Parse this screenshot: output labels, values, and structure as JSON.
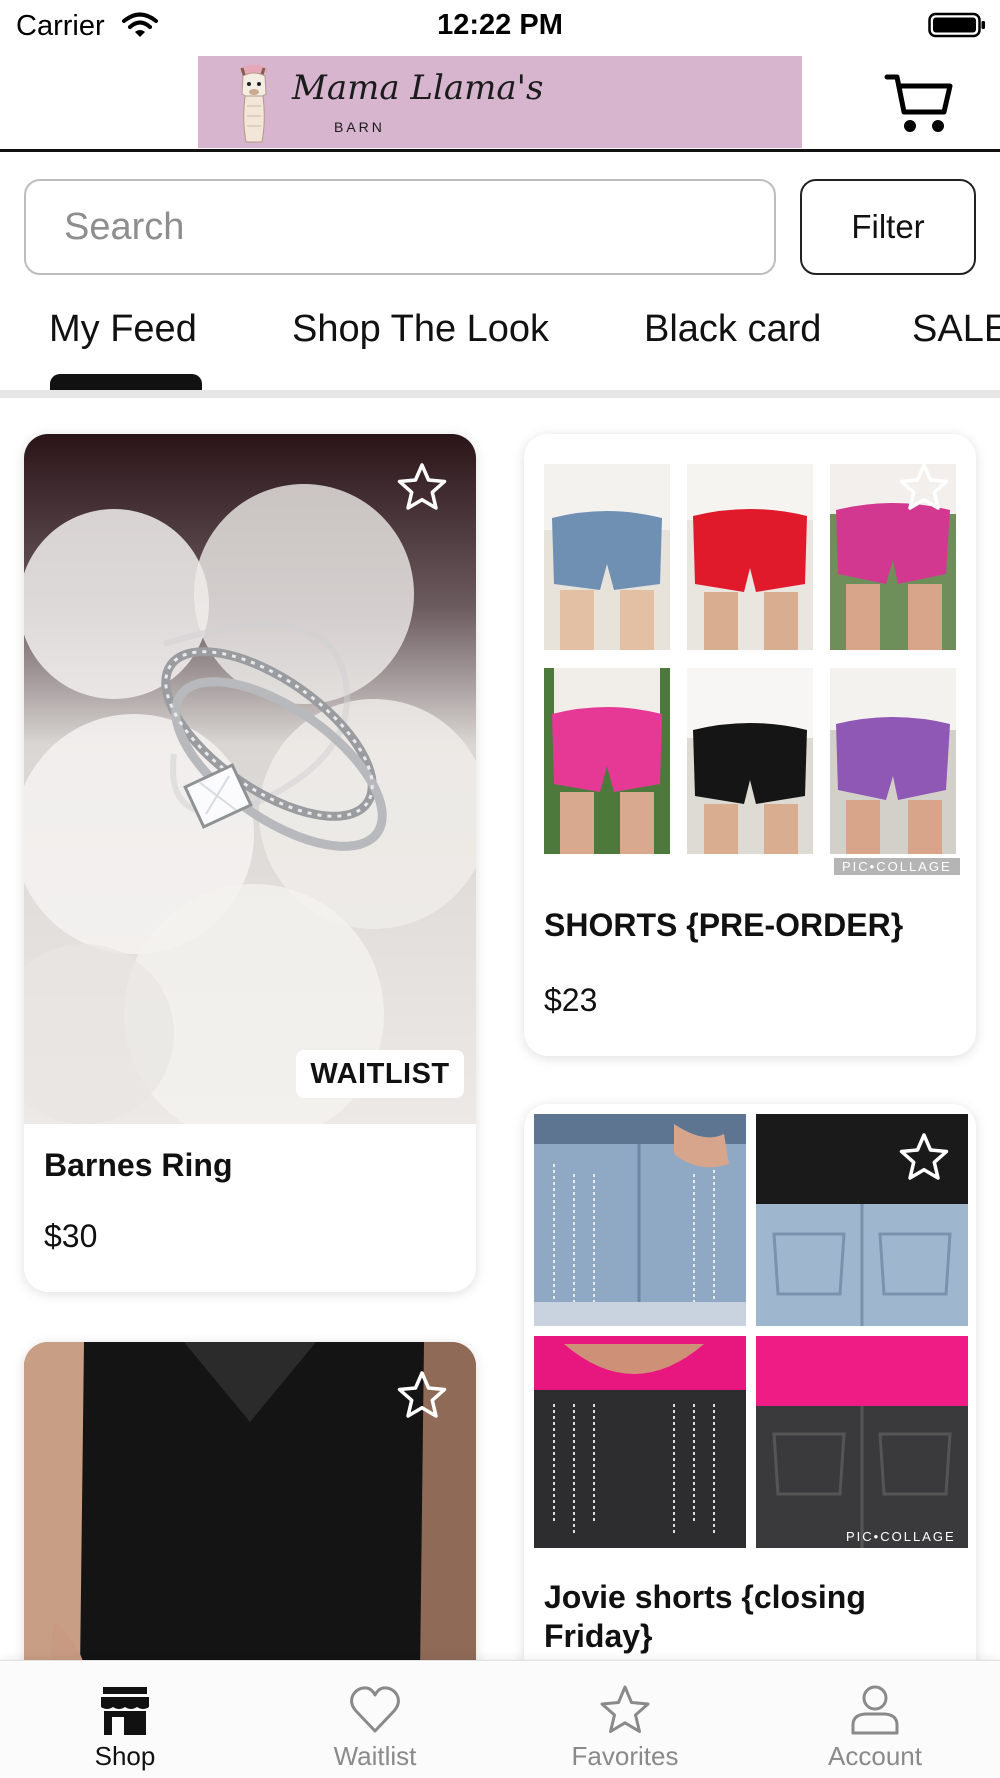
{
  "status_bar": {
    "carrier": "Carrier",
    "time": "12:22 PM"
  },
  "header": {
    "logo_script": "Mama Llama's",
    "logo_sub": "BARN"
  },
  "search": {
    "placeholder": "Search",
    "filter_label": "Filter"
  },
  "tabs": [
    {
      "label": "My Feed",
      "active": true
    },
    {
      "label": "Shop The Look"
    },
    {
      "label": "Black card"
    },
    {
      "label": "SALE"
    }
  ],
  "products": [
    {
      "title": "Barnes Ring",
      "price": "$30",
      "badge": "WAITLIST"
    },
    {
      "title": "SHORTS {PRE-ORDER}",
      "price": "$23",
      "watermark": "PIC•COLLAGE"
    },
    {
      "title": "Jovie shorts {closing Friday}",
      "watermark": "PIC•COLLAGE"
    },
    {
      "title": ""
    }
  ],
  "bottom_nav": [
    {
      "label": "Shop",
      "icon": "store-icon",
      "active": true
    },
    {
      "label": "Waitlist",
      "icon": "heart-icon"
    },
    {
      "label": "Favorites",
      "icon": "star-icon"
    },
    {
      "label": "Account",
      "icon": "person-icon"
    }
  ],
  "colors": {
    "logo_background": "#d7b5cf",
    "accent": "#111111",
    "inactive": "#8a8a8a"
  }
}
